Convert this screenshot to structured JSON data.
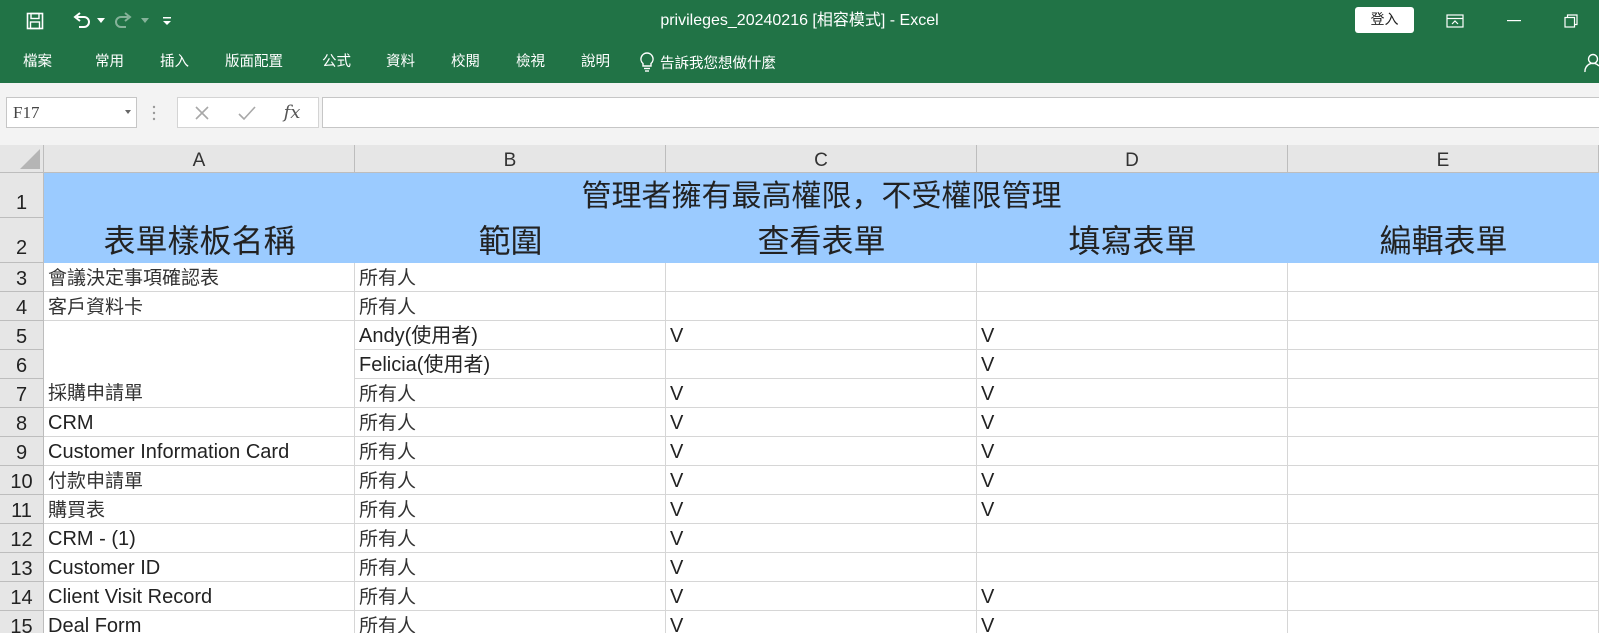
{
  "window": {
    "title": "privileges_20240216  [相容模式]  -  Excel",
    "signin_label": "登入"
  },
  "ribbon": {
    "tabs": [
      "檔案",
      "常用",
      "插入",
      "版面配置",
      "公式",
      "資料",
      "校閱",
      "檢視",
      "說明"
    ],
    "tell_me": "告訴我您想做什麼"
  },
  "formula_bar": {
    "name_box": "F17",
    "fx_label": "fx",
    "formula": ""
  },
  "sheet": {
    "columns": [
      "A",
      "B",
      "C",
      "D",
      "E"
    ],
    "row_numbers": [
      "1",
      "2",
      "3",
      "4",
      "5",
      "6",
      "7",
      "8",
      "9",
      "10",
      "11",
      "12",
      "13",
      "14",
      "15"
    ],
    "banner": "管理者擁有最高權限，不受權限管理",
    "headers": [
      "表單樣板名稱",
      "範圍",
      "查看表單",
      "填寫表單",
      "編輯表單"
    ],
    "rows": [
      {
        "a": "會議決定事項確認表",
        "b": "所有人",
        "c": "",
        "d": "",
        "e": ""
      },
      {
        "a": "客戶資料卡",
        "b": "所有人",
        "c": "",
        "d": "",
        "e": ""
      },
      {
        "a": "",
        "b": "Andy(使用者)",
        "c": "V",
        "d": "V",
        "e": ""
      },
      {
        "a": "",
        "b": "Felicia(使用者)",
        "c": "",
        "d": "V",
        "e": ""
      },
      {
        "a": "採購申請單",
        "b": "所有人",
        "c": "V",
        "d": "V",
        "e": ""
      },
      {
        "a": "CRM",
        "b": "所有人",
        "c": "V",
        "d": "V",
        "e": ""
      },
      {
        "a": "Customer Information Card",
        "b": "所有人",
        "c": "V",
        "d": "V",
        "e": ""
      },
      {
        "a": "付款申請單",
        "b": "所有人",
        "c": "V",
        "d": "V",
        "e": ""
      },
      {
        "a": "購買表",
        "b": "所有人",
        "c": "V",
        "d": "V",
        "e": ""
      },
      {
        "a": "CRM - (1)",
        "b": "所有人",
        "c": "V",
        "d": "",
        "e": ""
      },
      {
        "a": "Customer ID",
        "b": "所有人",
        "c": "V",
        "d": "",
        "e": ""
      },
      {
        "a": "Client Visit Record",
        "b": "所有人",
        "c": "V",
        "d": "V",
        "e": ""
      },
      {
        "a": "Deal Form",
        "b": "所有人",
        "c": "V",
        "d": "V",
        "e": ""
      }
    ]
  },
  "colors": {
    "excel_green": "#217346",
    "header_fill": "#9bcbff"
  }
}
